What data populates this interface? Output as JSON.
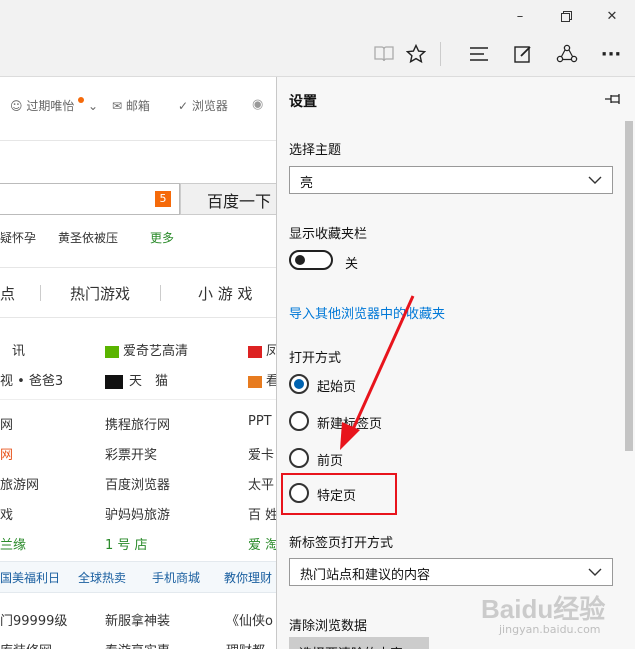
{
  "window": {
    "minimize_glyph": "–",
    "maximize_glyph": "❐",
    "close_glyph": "✕"
  },
  "toolbar": {
    "icons": [
      "reading-view-icon",
      "favorite-star-icon",
      "hub-icon",
      "web-note-icon",
      "share-icon",
      "more-icon"
    ],
    "more_glyph": "···"
  },
  "webpage": {
    "topnav": {
      "user": "过期唯怡",
      "mail": "邮箱",
      "browser": "浏览器"
    },
    "search": {
      "badge": "5",
      "button": "百度一下"
    },
    "hot_words": [
      "疑怀孕",
      "黄圣依被压",
      "更多"
    ],
    "tabs": [
      "点",
      "热门游戏",
      "小 游 戏"
    ],
    "rows": [
      [
        "讯",
        "爱奇艺高清",
        "凤"
      ],
      [
        "视 • 爸爸3",
        "天　猫",
        "看"
      ],
      [
        "网",
        "携程旅行网",
        "PPT"
      ],
      [
        "网",
        "彩票开奖",
        "爱卡"
      ],
      [
        "旅游网",
        "百度浏览器",
        "太平"
      ],
      [
        "戏",
        "驴妈妈旅游",
        "百 姓"
      ],
      [
        "兰缘",
        "1 号 店",
        "爱 淘"
      ]
    ],
    "links_bar": [
      "国美福利日",
      "全球热卖",
      "手机商城",
      "教你理财"
    ],
    "bottom_rows": [
      [
        "门99999级",
        "新服拿神装",
        "《仙侠o"
      ],
      [
        "库装修网",
        "春游享实惠",
        "理财都"
      ]
    ]
  },
  "settings": {
    "title": "设置",
    "theme_label": "选择主题",
    "theme_value": "亮",
    "favbar_label": "显示收藏夹栏",
    "favbar_state": "关",
    "import_link": "导入其他浏览器中的收藏夹",
    "open_with_label": "打开方式",
    "open_options": [
      "起始页",
      "新建标签页",
      "前页",
      "特定页"
    ],
    "open_selected_index": 0,
    "newtab_label": "新标签页打开方式",
    "newtab_value": "热门站点和建议的内容",
    "clear_label": "清除浏览数据",
    "clear_button": "选择要清除的内容"
  },
  "watermark": {
    "brand": "Baidu经验",
    "url": "jingyan.baidu.com"
  },
  "colors": {
    "accent": "#0063b1",
    "link": "#0078d7",
    "annotation": "#e8141c",
    "green_link": "#2a8a2a",
    "orange_badge": "#f56a0a"
  }
}
